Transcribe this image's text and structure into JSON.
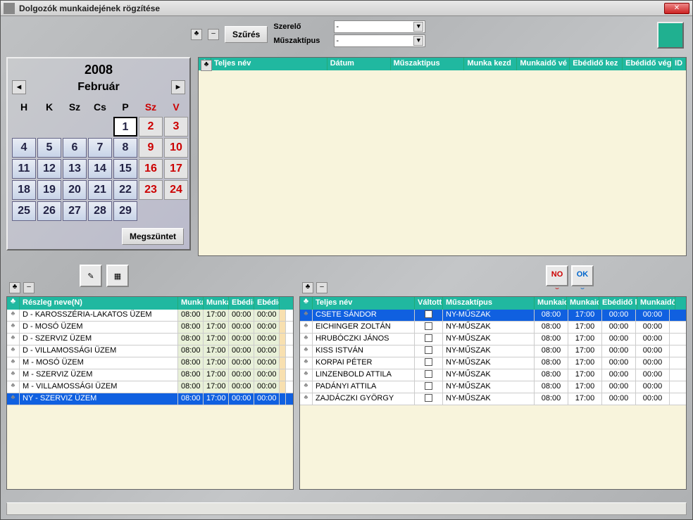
{
  "window_title": "Dolgozók munkaidejének rögzítése",
  "filters": {
    "btn_filter": "Szűrés",
    "label1": "Szerelő",
    "value1": "-",
    "label2": "Műszaktípus",
    "value2": "-"
  },
  "calendar": {
    "year": "2008",
    "month": "Február",
    "days_header": [
      "H",
      "K",
      "Sz",
      "Cs",
      "P",
      "Sz",
      "V"
    ],
    "selected_day": "1",
    "btn_cancel": "Megszüntet",
    "weeks": [
      [
        "",
        "",
        "",
        "",
        "1",
        "2",
        "3"
      ],
      [
        "4",
        "5",
        "6",
        "7",
        "8",
        "9",
        "10"
      ],
      [
        "11",
        "12",
        "13",
        "14",
        "15",
        "16",
        "17"
      ],
      [
        "18",
        "19",
        "20",
        "21",
        "22",
        "23",
        "24"
      ],
      [
        "25",
        "26",
        "27",
        "28",
        "29",
        "",
        ""
      ]
    ]
  },
  "top_grid_headers": [
    "Teljes név",
    "Dátum",
    "Műszaktípus",
    "Munka kezd",
    "Munkaidő vé",
    "Ebédidő kez",
    "Ebédidő vég",
    "ID"
  ],
  "left_grid": {
    "headers": [
      "Részleg neve(N)",
      "Munka",
      "Munka",
      "Ebédid",
      "Ebédid"
    ],
    "rows": [
      {
        "name": "D - KAROSSZÉRIA-LAKATOS ÜZEM",
        "t1": "08:00",
        "t2": "17:00",
        "t3": "00:00",
        "t4": "00:00"
      },
      {
        "name": "D - MOSÓ ÜZEM",
        "t1": "08:00",
        "t2": "17:00",
        "t3": "00:00",
        "t4": "00:00"
      },
      {
        "name": "D - SZERVIZ ÜZEM",
        "t1": "08:00",
        "t2": "17:00",
        "t3": "00:00",
        "t4": "00:00"
      },
      {
        "name": "D - VILLAMOSSÁGI ÜZEM",
        "t1": "08:00",
        "t2": "17:00",
        "t3": "00:00",
        "t4": "00:00"
      },
      {
        "name": "M - MOSÓ ÜZEM",
        "t1": "08:00",
        "t2": "17:00",
        "t3": "00:00",
        "t4": "00:00"
      },
      {
        "name": "M - SZERVIZ ÜZEM",
        "t1": "08:00",
        "t2": "17:00",
        "t3": "00:00",
        "t4": "00:00"
      },
      {
        "name": "M - VILLAMOSSÁGI ÜZEM",
        "t1": "08:00",
        "t2": "17:00",
        "t3": "00:00",
        "t4": "00:00"
      },
      {
        "name": "NY - SZERVIZ ÜZEM",
        "t1": "08:00",
        "t2": "17:00",
        "t3": "00:00",
        "t4": "00:00",
        "selected": true
      }
    ]
  },
  "right_grid": {
    "headers": [
      "Teljes név",
      "Váltott",
      "Műszaktípus",
      "Munkaid",
      "Munkaid",
      "Ebédidő k",
      "Munkaidő"
    ],
    "rows": [
      {
        "name": "CSETE SÁNDOR",
        "shift": "NY-MŰSZAK",
        "t1": "08:00",
        "t2": "17:00",
        "t3": "00:00",
        "t4": "00:00",
        "selected": true
      },
      {
        "name": "EICHINGER ZOLTÁN",
        "shift": "NY-MŰSZAK",
        "t1": "08:00",
        "t2": "17:00",
        "t3": "00:00",
        "t4": "00:00"
      },
      {
        "name": "HRUBÓCZKI JÁNOS",
        "shift": "NY-MŰSZAK",
        "t1": "08:00",
        "t2": "17:00",
        "t3": "00:00",
        "t4": "00:00"
      },
      {
        "name": "KISS ISTVÁN",
        "shift": "NY-MŰSZAK",
        "t1": "08:00",
        "t2": "17:00",
        "t3": "00:00",
        "t4": "00:00"
      },
      {
        "name": "KORPAI PÉTER",
        "shift": "NY-MŰSZAK",
        "t1": "08:00",
        "t2": "17:00",
        "t3": "00:00",
        "t4": "00:00"
      },
      {
        "name": "LINZENBOLD ATTILA",
        "shift": "NY-MŰSZAK",
        "t1": "08:00",
        "t2": "17:00",
        "t3": "00:00",
        "t4": "00:00"
      },
      {
        "name": "PADÁNYI ATTILA",
        "shift": "NY-MŰSZAK",
        "t1": "08:00",
        "t2": "17:00",
        "t3": "00:00",
        "t4": "00:00"
      },
      {
        "name": "ZAJDÁCZKI GYÖRGY",
        "shift": "NY-MŰSZAK",
        "t1": "08:00",
        "t2": "17:00",
        "t3": "00:00",
        "t4": "00:00"
      }
    ]
  },
  "buttons": {
    "no": "NO",
    "ok": "OK"
  }
}
